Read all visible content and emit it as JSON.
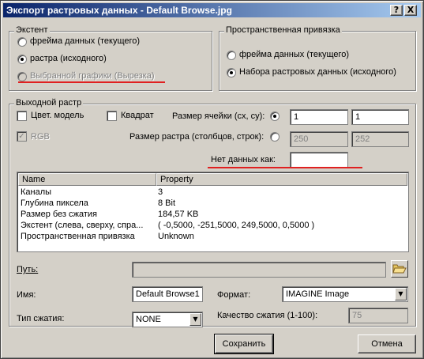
{
  "window": {
    "title": "Экспорт растровых данных - Default Browse.jpg",
    "help_btn": "?",
    "close_btn": "X"
  },
  "extent": {
    "title": "Экстент",
    "options": [
      {
        "label": "фрейма данных (текущего)",
        "checked": false,
        "enabled": true
      },
      {
        "label": "растра (исходного)",
        "checked": true,
        "enabled": true
      },
      {
        "label": "Выбранной графики (Вырезка)",
        "checked": false,
        "enabled": false
      }
    ]
  },
  "spatial_ref": {
    "title": "Пространственная привязка",
    "options": [
      {
        "label": "фрейма данных (текущего)",
        "checked": false
      },
      {
        "label": "Набора растровых данных (исходного)",
        "checked": true
      }
    ]
  },
  "output": {
    "title": "Выходной растр",
    "color_model": "Цвет. модель",
    "square": "Квадрат",
    "rgb": "RGB",
    "cell_size_label": "Размер ячейки (сх, су):",
    "cell_x": "1",
    "cell_y": "1",
    "raster_size_label": "Размер растра (столбцов, строк):",
    "cols": "250",
    "rows": "252",
    "nodata_label": "Нет данных как:",
    "nodata_value": ""
  },
  "properties": {
    "headers": [
      "Name",
      "Property"
    ],
    "rows": [
      [
        "Каналы",
        "3"
      ],
      [
        "Глубина пиксела",
        "8 Bit"
      ],
      [
        "Размер без сжатия",
        "184,57 KB"
      ],
      [
        "Экстент (слева, сверху, спра...",
        "( -0,5000, -251,5000, 249,5000, 0,5000 )"
      ],
      [
        "Пространственная привязка",
        "Unknown"
      ]
    ]
  },
  "path": {
    "label": "Путь:",
    "value": ""
  },
  "name": {
    "label": "Имя:",
    "value": "Default Browse1"
  },
  "format": {
    "label": "Формат:",
    "value": "IMAGINE Image"
  },
  "compression": {
    "label": "Тип сжатия:",
    "value": "NONE"
  },
  "quality": {
    "label": "Качество сжатия (1-100):",
    "value": "75"
  },
  "buttons": {
    "save": "Сохранить",
    "cancel": "Отмена"
  }
}
